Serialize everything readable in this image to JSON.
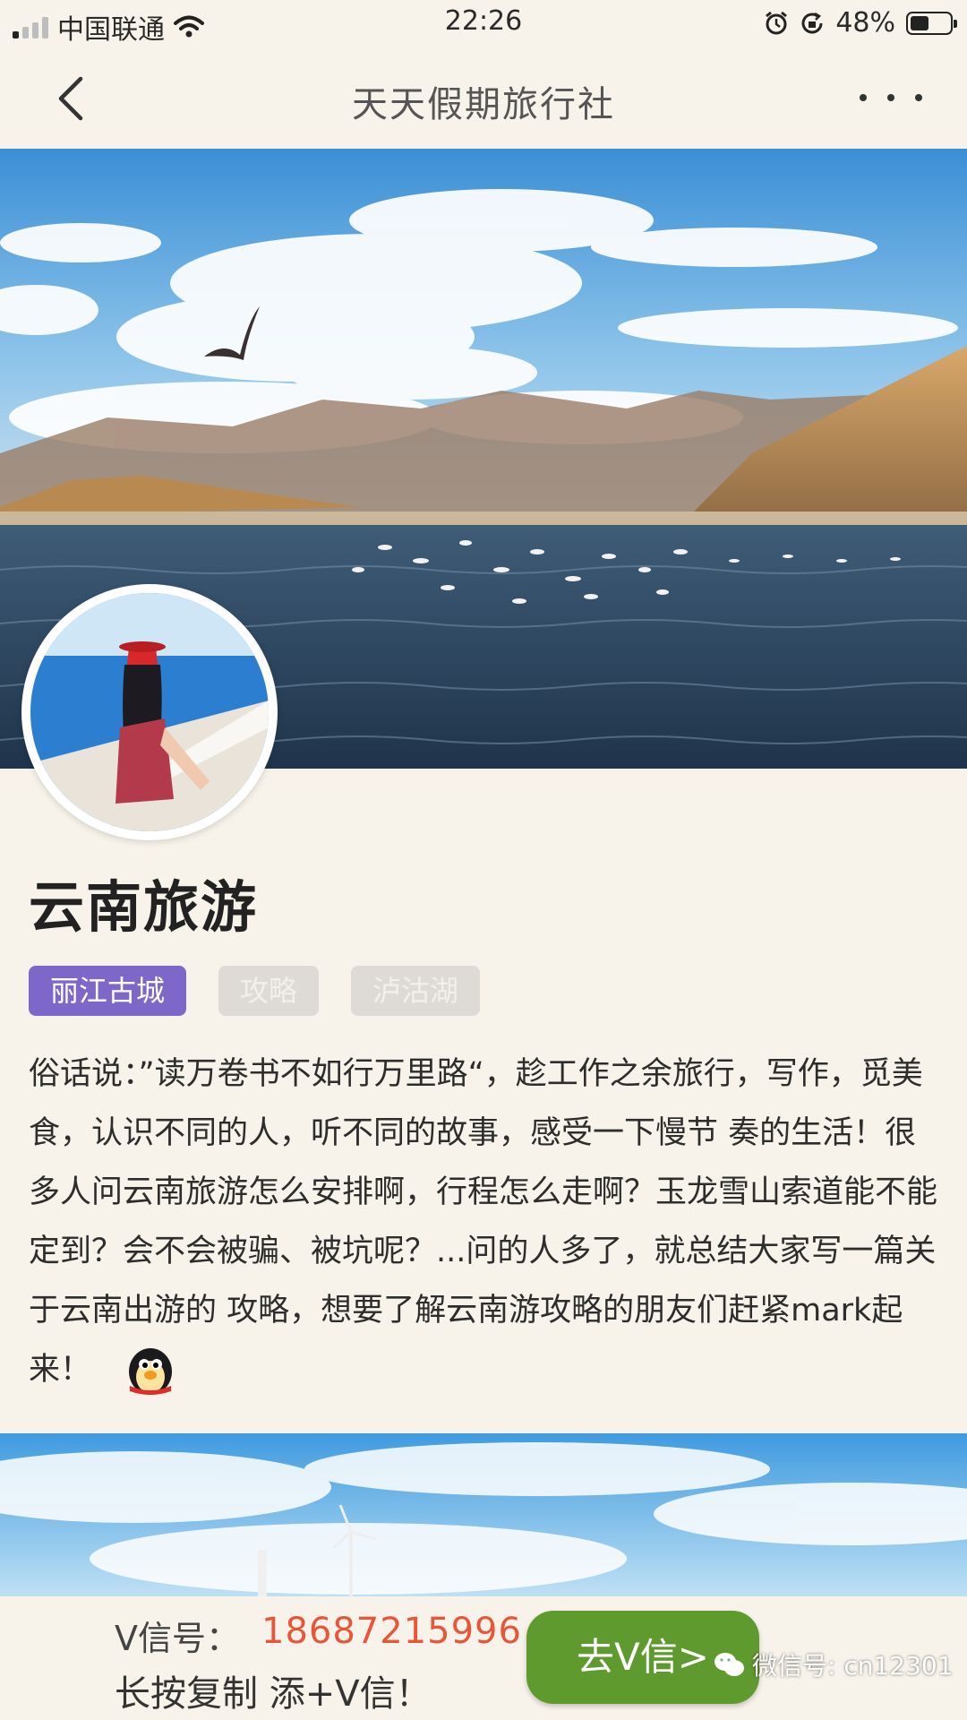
{
  "status_bar": {
    "carrier": "中国联通",
    "time": "22:26",
    "battery_percent": "48%",
    "battery_level": 0.48,
    "icons": [
      "signal-icon",
      "wifi-icon",
      "alarm-icon",
      "rotation-lock-icon",
      "battery-icon"
    ]
  },
  "nav": {
    "title": "天天假期旅行社",
    "icons": [
      "back-arrow-icon",
      "more-icon"
    ]
  },
  "article": {
    "title": "云南旅游",
    "tags": [
      {
        "label": "丽江古城",
        "active": true
      },
      {
        "label": "攻略",
        "active": false
      },
      {
        "label": "泸沽湖",
        "active": false
      }
    ],
    "body": "俗话说：”读万卷书不如行万里路“，趁工作之余旅行，写作，觅美食，认识不同的人，听不同的故事，感受一下慢节 奏的生活！很多人问云南旅游怎么安排啊，行程怎么走啊？玉龙雪山索道能不能定到？会不会被骗、被坑呢？...问的人多了，就总结大家写一篇关于云南出游的 攻略，想要了解云南游攻略的朋友们赶紧mark起来！"
  },
  "bottom_bar": {
    "wx_label": "V信号：",
    "wx_number": "18687215996",
    "copy_hint": "长按复制 添+V信！",
    "cta_label": "去V信>",
    "watermark": "微信号: cn12301"
  },
  "colors": {
    "background": "#f8f3ea",
    "tag_active": "#7d68c9",
    "tag_inactive": "#dedbd6",
    "phone_number": "#e8563a",
    "cta_button": "#5f9a2f"
  }
}
